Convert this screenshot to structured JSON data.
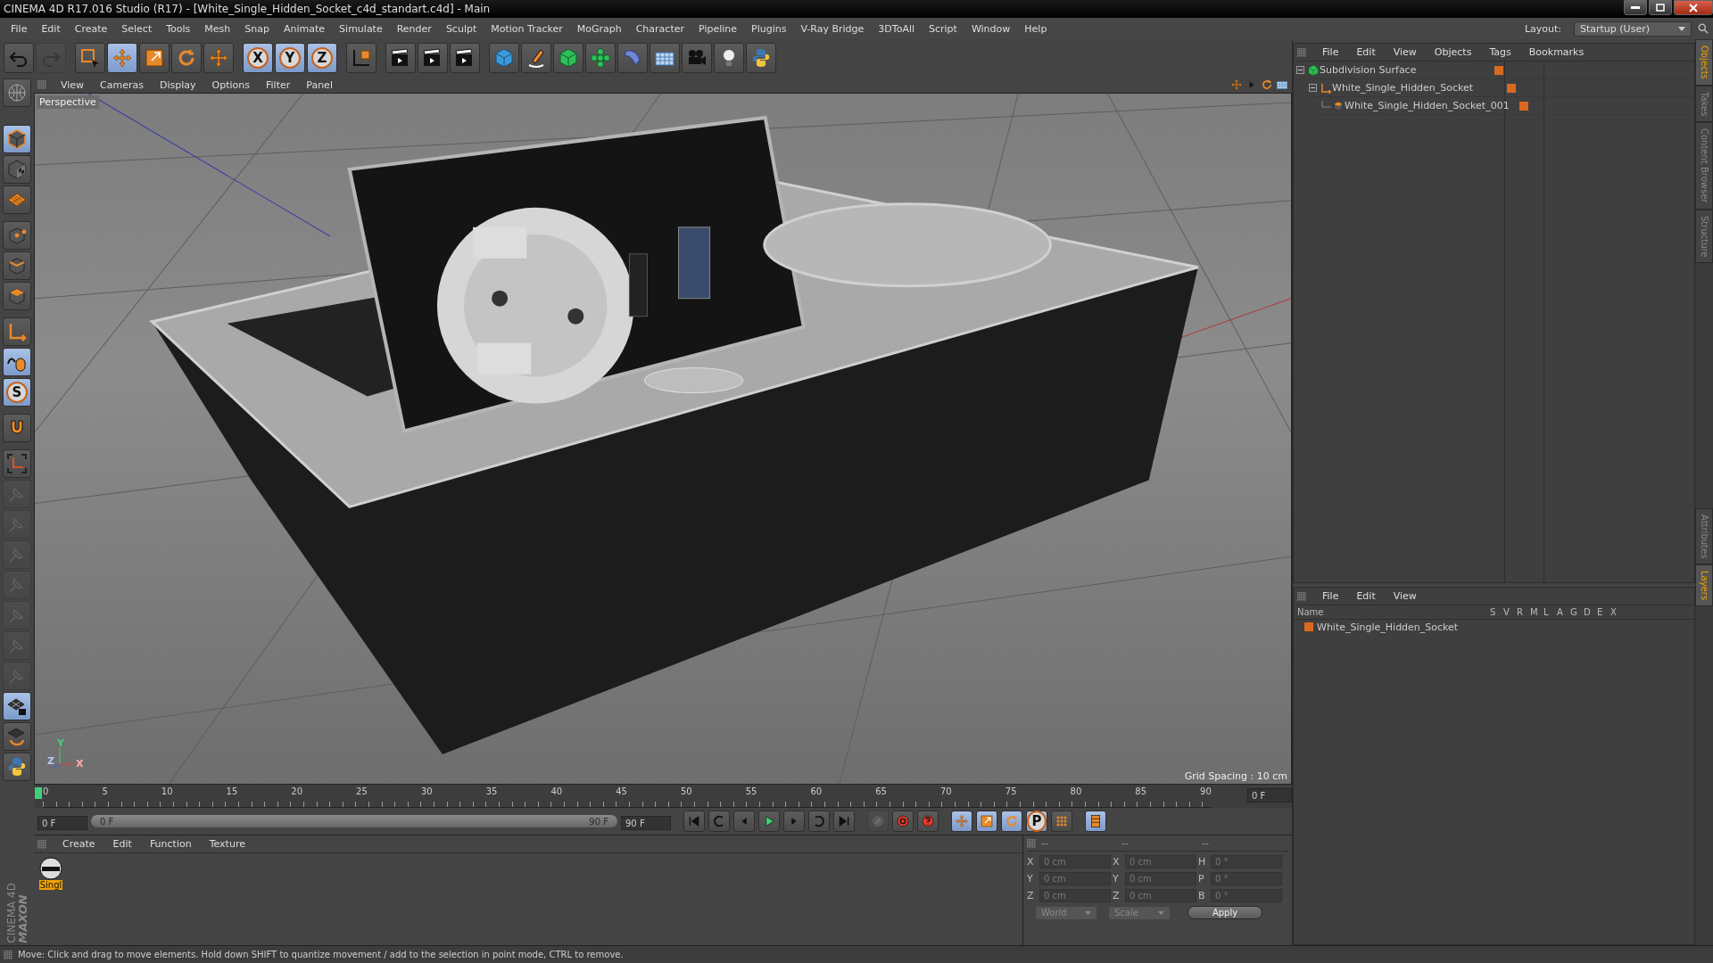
{
  "window": {
    "title": "CINEMA 4D R17.016 Studio (R17) - [White_Single_Hidden_Socket_c4d_standart.c4d] - Main"
  },
  "menu": [
    "File",
    "Edit",
    "Create",
    "Select",
    "Tools",
    "Mesh",
    "Snap",
    "Animate",
    "Simulate",
    "Render",
    "Sculpt",
    "Motion Tracker",
    "MoGraph",
    "Character",
    "Pipeline",
    "Plugins",
    "V-Ray Bridge",
    "3DToAll",
    "Script",
    "Window",
    "Help"
  ],
  "layout": {
    "label": "Layout:",
    "value": "Startup (User)"
  },
  "toolbar": [
    {
      "selected": false,
      "disabled": false
    },
    {
      "selected": false,
      "disabled": true
    },
    {
      "selected": false,
      "disabled": false
    },
    {
      "selected": true,
      "disabled": false
    },
    {
      "selected": false,
      "disabled": false
    },
    {
      "selected": false,
      "disabled": false
    },
    {
      "selected": false,
      "disabled": false
    },
    {
      "selected": true,
      "disabled": false,
      "label": "X"
    },
    {
      "selected": true,
      "disabled": false,
      "label": "Y"
    },
    {
      "selected": true,
      "disabled": false,
      "label": "Z"
    },
    {
      "selected": false,
      "disabled": false
    },
    {
      "selected": false,
      "disabled": false
    },
    {
      "selected": false,
      "disabled": false
    },
    {
      "selected": false,
      "disabled": false
    },
    {
      "selected": false,
      "disabled": false
    },
    {
      "selected": false,
      "disabled": false
    },
    {
      "selected": false,
      "disabled": false
    },
    {
      "selected": false,
      "disabled": false
    },
    {
      "selected": false,
      "disabled": false
    },
    {
      "selected": false,
      "disabled": false
    },
    {
      "selected": false,
      "disabled": false
    },
    {
      "selected": false,
      "disabled": false
    },
    {
      "selected": false,
      "disabled": false
    }
  ],
  "left_tools": [
    {
      "selected": false,
      "disabled": false
    },
    {
      "selected": true,
      "disabled": false
    },
    {
      "selected": false,
      "disabled": false
    },
    {
      "selected": false,
      "disabled": false
    },
    {
      "selected": false,
      "disabled": false
    },
    {
      "selected": false,
      "disabled": false
    },
    {
      "selected": false,
      "disabled": false
    },
    {
      "selected": false,
      "disabled": false
    },
    {
      "selected": true,
      "disabled": false
    },
    {
      "selected": true,
      "disabled": false,
      "label": "S"
    },
    {
      "selected": false,
      "disabled": false
    },
    {
      "selected": false,
      "disabled": false
    },
    {
      "selected": false,
      "disabled": true
    },
    {
      "selected": false,
      "disabled": true
    },
    {
      "selected": false,
      "disabled": true
    },
    {
      "selected": false,
      "disabled": true
    },
    {
      "selected": false,
      "disabled": true
    },
    {
      "selected": false,
      "disabled": true
    },
    {
      "selected": false,
      "disabled": true
    },
    {
      "selected": true,
      "disabled": false
    },
    {
      "selected": false,
      "disabled": false
    },
    {
      "selected": false,
      "disabled": false
    }
  ],
  "brand": [
    "MAXON",
    "CINEMA 4D"
  ],
  "viewport": {
    "menu": [
      "View",
      "Cameras",
      "Display",
      "Options",
      "Filter",
      "Panel"
    ],
    "camera": "Perspective",
    "grid_spacing": "Grid Spacing : 10 cm",
    "axis_labels": [
      "Z",
      "Y",
      "X"
    ]
  },
  "timeline": {
    "ticks": [
      "0",
      "5",
      "10",
      "15",
      "20",
      "25",
      "30",
      "35",
      "40",
      "45",
      "50",
      "55",
      "60",
      "65",
      "70",
      "75",
      "80",
      "85",
      "90"
    ],
    "level": 0,
    "current": "0 F",
    "start": "0 F",
    "range": {
      "start": "0 F",
      "end": "90 F",
      "level": 1
    },
    "end": "90 F"
  },
  "transport": [
    {
      "selected": false,
      "disabled": false
    },
    {
      "selected": false,
      "disabled": false
    },
    {
      "selected": false,
      "disabled": false
    },
    {
      "selected": false,
      "disabled": false
    },
    {
      "selected": false,
      "disabled": false
    },
    {
      "selected": false,
      "disabled": false
    },
    {
      "selected": false,
      "disabled": false
    },
    {
      "selected": false,
      "disabled": true
    },
    {
      "selected": false,
      "disabled": false
    },
    {
      "selected": false,
      "disabled": false
    },
    {
      "selected": true,
      "disabled": false
    },
    {
      "selected": true,
      "disabled": false
    },
    {
      "selected": true,
      "disabled": false
    },
    {
      "selected": true,
      "disabled": false,
      "label": "P"
    },
    {
      "selected": false,
      "disabled": false
    },
    {
      "selected": true,
      "disabled": false
    }
  ],
  "materials": {
    "menu": [
      "Create",
      "Edit",
      "Function",
      "Texture"
    ],
    "items": [
      {
        "name": "Singl",
        "selected": true
      }
    ]
  },
  "coordinates": {
    "headers": [
      "--",
      "--",
      "--"
    ],
    "rows": [
      {
        "axis": "X",
        "position": "0 cm",
        "size_axis": "X",
        "size": "0 cm",
        "rot_axis": "H",
        "rotation": "0 °"
      },
      {
        "axis": "Y",
        "position": "0 cm",
        "size_axis": "Y",
        "size": "0 cm",
        "rot_axis": "P",
        "rotation": "0 °"
      },
      {
        "axis": "Z",
        "position": "0 cm",
        "size_axis": "Z",
        "size": "0 cm",
        "rot_axis": "B",
        "rotation": "0 °"
      }
    ],
    "mode": "World",
    "size_mode": "Scale",
    "apply": "Apply"
  },
  "objects": {
    "menu": [
      "File",
      "Edit",
      "View",
      "Objects",
      "Tags",
      "Bookmarks"
    ],
    "tree": [
      {
        "name": "Subdivision Surface",
        "expanded": true,
        "children": [
          {
            "name": "White_Single_Hidden_Socket",
            "expanded": true,
            "children": [
              {
                "name": "White_Single_Hidden_Socket_001"
              }
            ]
          }
        ]
      }
    ]
  },
  "layers": {
    "menu": [
      "File",
      "Edit",
      "View"
    ],
    "columns": [
      "Name",
      "S",
      "V",
      "R",
      "M",
      "L",
      "A",
      "G",
      "D",
      "E",
      "X"
    ],
    "rows": [
      {
        "name": "White_Single_Hidden_Socket"
      }
    ]
  },
  "side_tabs": {
    "top": [
      {
        "label": "Objects",
        "selected": true
      },
      {
        "label": "Takes",
        "selected": false
      },
      {
        "label": "Content Browser",
        "selected": false
      },
      {
        "label": "Structure",
        "selected": false
      }
    ],
    "bottom": [
      {
        "label": "Attributes",
        "selected": false
      },
      {
        "label": "Layers",
        "selected": true
      }
    ]
  },
  "status": "Move: Click and drag to move elements. Hold down SHIFT to quantize movement / add to the selection in point mode, CTRL to remove."
}
